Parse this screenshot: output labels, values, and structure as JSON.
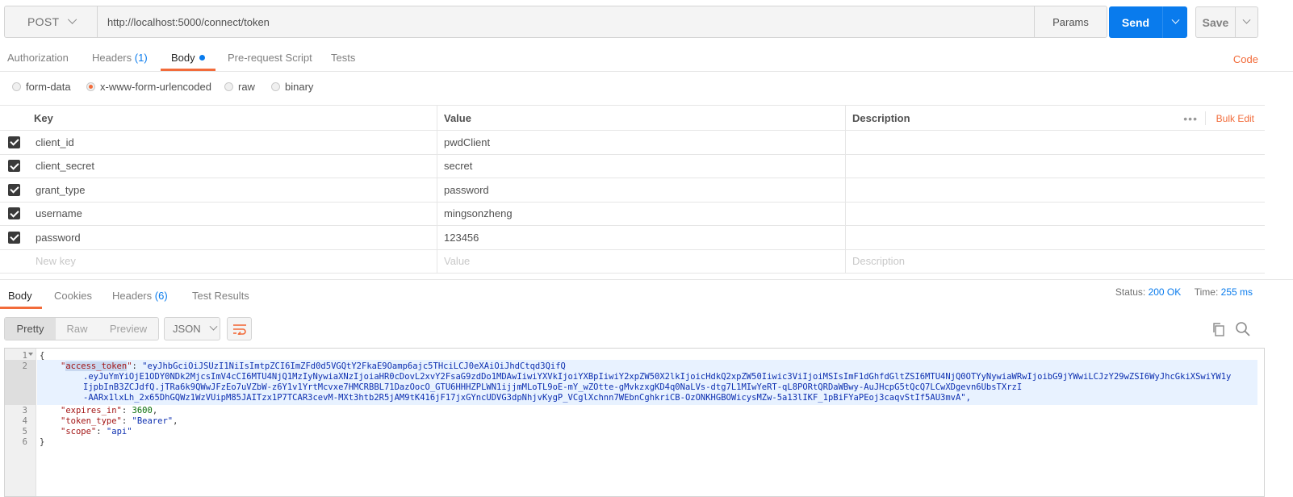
{
  "request": {
    "method": "POST",
    "url": "http://localhost:5000/connect/token",
    "params_label": "Params",
    "send_label": "Send",
    "save_label": "Save"
  },
  "request_tabs": {
    "authorization": "Authorization",
    "headers": "Headers",
    "headers_count": "(1)",
    "body": "Body",
    "prerequest": "Pre-request Script",
    "tests": "Tests",
    "code": "Code"
  },
  "body_types": {
    "form_data": "form-data",
    "urlencoded": "x-www-form-urlencoded",
    "raw": "raw",
    "binary": "binary",
    "selected": "x-www-form-urlencoded"
  },
  "params_table": {
    "headers": {
      "key": "Key",
      "value": "Value",
      "description": "Description"
    },
    "more": "•••",
    "bulk_edit": "Bulk Edit",
    "rows": [
      {
        "key": "client_id",
        "value": "pwdClient",
        "description": ""
      },
      {
        "key": "client_secret",
        "value": "secret",
        "description": ""
      },
      {
        "key": "grant_type",
        "value": "password",
        "description": ""
      },
      {
        "key": "username",
        "value": "mingsonzheng",
        "description": ""
      },
      {
        "key": "password",
        "value": "123456",
        "description": ""
      }
    ],
    "new_row": {
      "key": "New key",
      "value": "Value",
      "description": "Description"
    }
  },
  "response_tabs": {
    "body": "Body",
    "cookies": "Cookies",
    "headers": "Headers",
    "headers_count": "(6)",
    "test_results": "Test Results",
    "status_label": "Status:",
    "status_value": "200 OK",
    "time_label": "Time:",
    "time_value": "255 ms"
  },
  "response_toolbar": {
    "pretty": "Pretty",
    "raw": "Raw",
    "preview": "Preview",
    "format": "JSON"
  },
  "response_body": {
    "line_numbers": [
      "1",
      "2",
      "3",
      "4",
      "5",
      "6"
    ],
    "open_brace": "{",
    "close_brace": "}",
    "access_token_key": "\"access_token\"",
    "access_token_lines": [
      "\"eyJhbGciOiJSUzI1NiIsImtpZCI6ImZFd0d5VGQtY2FkaE9Oamp6ajc5THciLCJ0eXAiOiJhdCtqd3QifQ",
      ".eyJuYmYiOjE1ODY0NDk2MjcsImV4cCI6MTU4NjQ1MzIyNywiaXNzIjoiaHR0cDovL2xvY2FsaG9zdDo1MDAwIiwiYXVkIjoiYXBpIiwiY2xpZW50X2lkIjoicHdkQ2xpZW50Iiwic3ViIjoiMSIsImF1dGhfdGltZSI6MTU4NjQ0OTYyNywiaWRwIjoibG9jYWwiLCJzY29wZSI6WyJhcGkiXSwiYW1y",
      "IjpbInB3ZCJdfQ.jTRa6k9QWwJFzEo7uVZbW-z6Y1v1YrtMcvxe7HMCRBBL71DazOocO_GTU6HHHZPLWN1ijjmMLoTL9oE-mY_wZOtte-gMvkzxgKD4q0NaLVs-dtg7L1MIwYeRT-qL8PORtQRDaWBwy-AuJHcpG5tQcQ7LCwXDgevn6UbsTXrzI",
      "-AARx1lxLh_2x65DhGQWz1WzVUipM85JAITzx1P7TCAR3cevM-MXt3htb2R5jAM9tK416jF17jxGYncUDVG3dpNhjvKygP_VCglXchnn7WEbnCghkriCB-OzONKHGBOWicysMZw-5a13lIKF_1pBiFYaPEoj3caqvStIf5AU3mvA\","
    ],
    "expires_in_key": "\"expires_in\"",
    "expires_in_value": "3600",
    "token_type_key": "\"token_type\"",
    "token_type_value": "\"Bearer\"",
    "scope_key": "\"scope\"",
    "scope_value": "\"api\""
  },
  "colors": {
    "accent_orange": "#f26b3a",
    "send_blue": "#097bed"
  }
}
